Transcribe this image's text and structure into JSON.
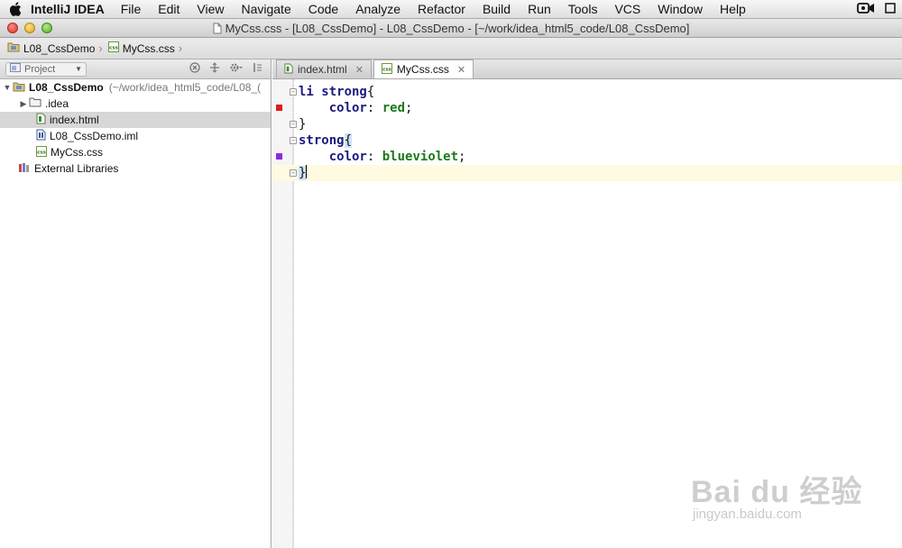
{
  "menubar": {
    "app_name": "IntelliJ IDEA",
    "items": [
      "File",
      "Edit",
      "View",
      "Navigate",
      "Code",
      "Analyze",
      "Refactor",
      "Build",
      "Run",
      "Tools",
      "VCS",
      "Window",
      "Help"
    ]
  },
  "window": {
    "title": "MyCss.css - [L08_CssDemo] - L08_CssDemo - [~/work/idea_html5_code/L08_CssDemo]"
  },
  "navbar": {
    "breadcrumbs": [
      "L08_CssDemo",
      "MyCss.css"
    ]
  },
  "project_panel": {
    "view_label": "Project",
    "tree": [
      {
        "label": "L08_CssDemo",
        "path": "(~/work/idea_html5_code/L08_(",
        "kind": "module",
        "expanded": true
      },
      {
        "label": ".idea",
        "kind": "folder",
        "expanded": false
      },
      {
        "label": "index.html",
        "kind": "html",
        "selected": true
      },
      {
        "label": "L08_CssDemo.iml",
        "kind": "iml"
      },
      {
        "label": "MyCss.css",
        "kind": "css"
      },
      {
        "label": "External Libraries",
        "kind": "library"
      }
    ]
  },
  "editor": {
    "tabs": [
      {
        "label": "index.html",
        "active": false
      },
      {
        "label": "MyCss.css",
        "active": true
      }
    ],
    "code": {
      "rule1_selector": "li strong",
      "rule1_property": "color",
      "rule1_value": "red",
      "rule2_selector": "strong",
      "rule2_property": "color",
      "rule2_value": "blueviolet",
      "open_brace": "{",
      "close_brace": "}",
      "colon": ":",
      "semicolon": ";"
    },
    "colors": {
      "red_swatch": "#e01b1b",
      "blueviolet_swatch": "#8a2be2"
    }
  },
  "watermark": {
    "logo": "Bai du 经验",
    "url": "jingyan.baidu.com"
  }
}
